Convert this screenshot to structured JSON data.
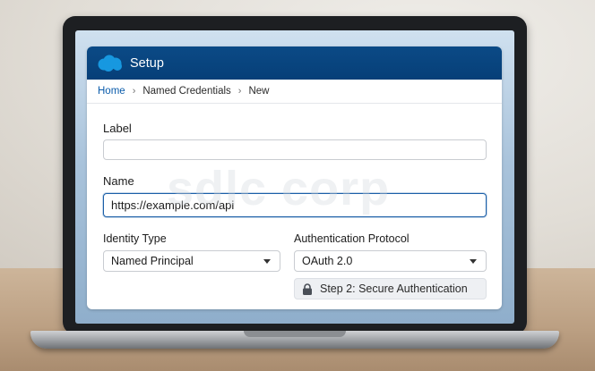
{
  "app": {
    "title": "Setup"
  },
  "breadcrumb": {
    "items": [
      "Home",
      "Named Credentials",
      "New"
    ]
  },
  "form": {
    "label": {
      "label": "Label",
      "value": ""
    },
    "name": {
      "label": "Name",
      "value": "https://example.com/api"
    },
    "identity_type": {
      "label": "Identity Type",
      "selected": "Named Principal"
    },
    "auth_protocol": {
      "label": "Authentication Protocol",
      "selected": "OAuth 2.0"
    },
    "step": {
      "label": "Step 2: Secure Authentication",
      "icon": "lock-icon"
    }
  },
  "watermark": "sdlc corp",
  "colors": {
    "header": "#0b4a86",
    "link": "#0b5cab",
    "focus": "#1b5fa8"
  }
}
